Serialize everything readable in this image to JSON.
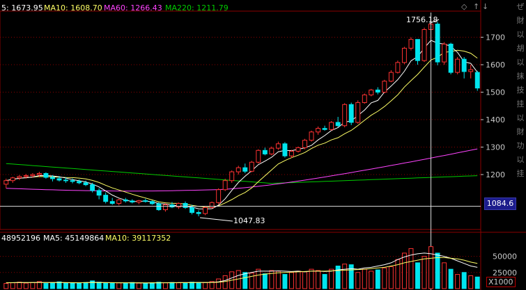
{
  "header": {
    "ma5_label": "5: 1673.95",
    "ma10_label": "MA10: 1608.70",
    "ma60_label": "MA60: 1266.43",
    "ma220_label": "MA220: 1211.79",
    "icons": [
      "diamond-icon",
      "up-arrow-icon",
      "down-arrow-icon"
    ]
  },
  "indicator_header": {
    "vol_label": "48952196",
    "ma5_label": "MA5: 45149864",
    "ma10_label": "MA10: 39117352"
  },
  "annotations": {
    "high_label": "1756.18",
    "low_label": "1047.83",
    "crosshair_value": "1084.6",
    "unit_label": "X1000"
  },
  "right_strip": {
    "glyphs": [
      "ぜ",
      "財",
      "以",
      "胡",
      "以",
      "抹",
      "技",
      "挂",
      "以",
      "財",
      "功",
      "以",
      "挂"
    ]
  },
  "colors": {
    "background": "#000000",
    "up": "#ff3232",
    "down": "#00e5ee",
    "ma5": "#ffffff",
    "ma10": "#ffff66",
    "ma60": "#ff44ff",
    "ma220": "#00cc00",
    "grid": "#8b0000",
    "crosshair": "#dddddd"
  },
  "chart_data": [
    {
      "type": "candlestick",
      "title": "",
      "ylim": [
        1000,
        1790
      ],
      "yticks": [
        1200,
        1300,
        1400,
        1500,
        1600,
        1700
      ],
      "ohlc": [
        [
          1165,
          1185,
          1150,
          1178
        ],
        [
          1178,
          1192,
          1170,
          1188
        ],
        [
          1188,
          1198,
          1180,
          1193
        ],
        [
          1193,
          1202,
          1185,
          1196
        ],
        [
          1196,
          1205,
          1188,
          1200
        ],
        [
          1200,
          1210,
          1190,
          1204
        ],
        [
          1204,
          1208,
          1185,
          1190
        ],
        [
          1190,
          1198,
          1175,
          1185
        ],
        [
          1185,
          1195,
          1175,
          1180
        ],
        [
          1180,
          1190,
          1170,
          1178
        ],
        [
          1178,
          1186,
          1168,
          1175
        ],
        [
          1175,
          1182,
          1165,
          1170
        ],
        [
          1170,
          1178,
          1158,
          1163
        ],
        [
          1163,
          1170,
          1135,
          1142
        ],
        [
          1142,
          1150,
          1110,
          1125
        ],
        [
          1125,
          1135,
          1095,
          1102
        ],
        [
          1102,
          1115,
          1090,
          1095
        ],
        [
          1095,
          1112,
          1088,
          1108
        ],
        [
          1108,
          1115,
          1098,
          1104
        ],
        [
          1104,
          1110,
          1095,
          1100
        ],
        [
          1100,
          1108,
          1092,
          1105
        ],
        [
          1105,
          1112,
          1098,
          1102
        ],
        [
          1102,
          1106,
          1090,
          1094
        ],
        [
          1094,
          1100,
          1068,
          1072
        ],
        [
          1072,
          1095,
          1065,
          1090
        ],
        [
          1090,
          1100,
          1078,
          1082
        ],
        [
          1082,
          1098,
          1075,
          1095
        ],
        [
          1095,
          1102,
          1075,
          1080
        ],
        [
          1080,
          1090,
          1055,
          1062
        ],
        [
          1062,
          1070,
          1048,
          1058
        ],
        [
          1058,
          1085,
          1052,
          1080
        ],
        [
          1080,
          1102,
          1075,
          1098
        ],
        [
          1098,
          1150,
          1092,
          1145
        ],
        [
          1145,
          1185,
          1140,
          1178
        ],
        [
          1178,
          1215,
          1170,
          1210
        ],
        [
          1210,
          1232,
          1200,
          1225
        ],
        [
          1225,
          1240,
          1205,
          1212
        ],
        [
          1212,
          1250,
          1208,
          1245
        ],
        [
          1245,
          1292,
          1240,
          1288
        ],
        [
          1288,
          1298,
          1270,
          1275
        ],
        [
          1275,
          1302,
          1270,
          1296
        ],
        [
          1296,
          1320,
          1290,
          1312
        ],
        [
          1312,
          1318,
          1262,
          1268
        ],
        [
          1268,
          1290,
          1260,
          1285
        ],
        [
          1285,
          1302,
          1280,
          1298
        ],
        [
          1298,
          1330,
          1292,
          1325
        ],
        [
          1325,
          1360,
          1320,
          1355
        ],
        [
          1355,
          1375,
          1345,
          1368
        ],
        [
          1368,
          1378,
          1360,
          1364
        ],
        [
          1364,
          1395,
          1360,
          1390
        ],
        [
          1390,
          1410,
          1372,
          1378
        ],
        [
          1378,
          1460,
          1372,
          1455
        ],
        [
          1455,
          1462,
          1380,
          1390
        ],
        [
          1390,
          1470,
          1385,
          1462
        ],
        [
          1462,
          1495,
          1458,
          1490
        ],
        [
          1490,
          1512,
          1485,
          1508
        ],
        [
          1508,
          1518,
          1492,
          1500
        ],
        [
          1500,
          1545,
          1496,
          1540
        ],
        [
          1540,
          1580,
          1536,
          1572
        ],
        [
          1572,
          1615,
          1568,
          1608
        ],
        [
          1608,
          1665,
          1602,
          1660
        ],
        [
          1660,
          1700,
          1652,
          1692
        ],
        [
          1692,
          1690,
          1600,
          1615
        ],
        [
          1615,
          1735,
          1610,
          1728
        ],
        [
          1728,
          1756,
          1690,
          1748
        ],
        [
          1748,
          1756,
          1598,
          1610
        ],
        [
          1610,
          1682,
          1600,
          1675
        ],
        [
          1675,
          1680,
          1565,
          1572
        ],
        [
          1572,
          1628,
          1565,
          1620
        ],
        [
          1620,
          1628,
          1550,
          1575
        ],
        [
          1575,
          1600,
          1550,
          1582
        ],
        [
          1572,
          1578,
          1505,
          1515
        ]
      ]
    },
    {
      "type": "bar",
      "title": "",
      "ylim": [
        0,
        70000
      ],
      "yticks": [
        25000,
        50000
      ],
      "values": [
        8000,
        9000,
        10000,
        8500,
        9500,
        11000,
        8000,
        9000,
        10500,
        9000,
        8500,
        9000,
        9500,
        12000,
        10000,
        9000,
        8500,
        9000,
        8000,
        9500,
        8500,
        8000,
        9000,
        10000,
        9000,
        9500,
        9000,
        9000,
        10000,
        9500,
        9500,
        11000,
        15000,
        20000,
        26000,
        28000,
        25000,
        24000,
        30000,
        23000,
        28000,
        27000,
        22000,
        25000,
        27000,
        26000,
        30000,
        28000,
        22000,
        30000,
        35000,
        38000,
        37000,
        25000,
        30000,
        27000,
        29000,
        32000,
        34000,
        45000,
        55000,
        62000,
        40000,
        50000,
        65000,
        55000,
        40000,
        30000,
        22000,
        25000,
        20000,
        18000
      ],
      "series": [
        {
          "name": "MA5",
          "values": [
            9000,
            9200,
            9400,
            9300,
            9500,
            9600,
            9400,
            9500,
            9600,
            9200,
            9100,
            9000,
            9300,
            9800,
            9600,
            9400,
            9300,
            9100,
            9000,
            9100,
            8800,
            8700,
            8900,
            9000,
            9200,
            9300,
            9400,
            9400,
            9500,
            9600,
            9500,
            9700,
            10500,
            12500,
            16500,
            20500,
            23000,
            25000,
            27000,
            27000,
            27000,
            27500,
            27000,
            26500,
            27000,
            26000,
            27000,
            27000,
            26500,
            27000,
            29000,
            30000,
            31000,
            30000,
            32000,
            33000,
            35000,
            37000,
            40000,
            45000,
            49000,
            52000,
            54000,
            55000,
            54000,
            52000,
            50000,
            47000,
            43000,
            39000,
            35000,
            33000
          ]
        },
        {
          "name": "MA10",
          "values": [
            9200,
            9300,
            9400,
            9400,
            9500,
            9500,
            9400,
            9400,
            9500,
            9400,
            9300,
            9200,
            9300,
            9400,
            9300,
            9200,
            9200,
            9100,
            9000,
            9100,
            9000,
            8900,
            9000,
            9000,
            9100,
            9100,
            9200,
            9200,
            9300,
            9400,
            9400,
            9500,
            10000,
            11000,
            13000,
            15000,
            17000,
            19000,
            21000,
            22500,
            23500,
            24500,
            25000,
            25500,
            26000,
            26500,
            27000,
            27000,
            27000,
            27500,
            28000,
            28500,
            29000,
            29500,
            30000,
            31000,
            32000,
            33000,
            35000,
            37000,
            40000,
            42000,
            44000,
            46000,
            47000,
            48000,
            48000,
            47000,
            46000,
            44000,
            41000,
            39000
          ]
        }
      ]
    }
  ]
}
